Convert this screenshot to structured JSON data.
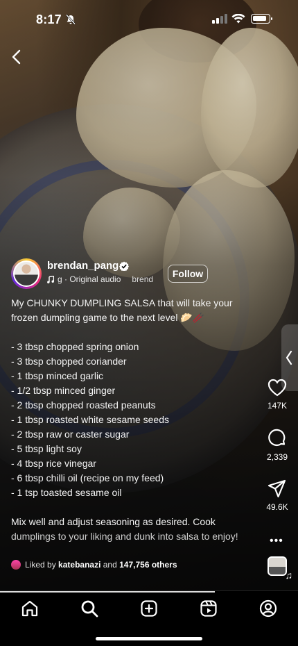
{
  "status_bar": {
    "time": "8:17"
  },
  "post": {
    "username": "brendan_pang",
    "audio_prefix": "g · Original audio",
    "audio_overflow": "brend",
    "follow_label": "Follow",
    "caption_intro": "My CHUNKY DUMPLING SALSA that will take your frozen dumpling game to the next level 🥟🥢",
    "ingredients": [
      "- 3 tbsp chopped spring onion",
      "- 3 tbsp chopped coriander",
      "- 1 tbsp minced garlic",
      "- 1/2 tbsp minced ginger",
      "- 2 tbsp chopped roasted peanuts",
      "- 1 tbsp roasted white sesame seeds",
      "- 2 tbsp raw or caster sugar",
      "- 5 tbsp light soy",
      "- 4 tbsp rice vinegar",
      "- 6 tbsp chilli oil (recipe on my feed)",
      "- 1 tsp toasted sesame oil"
    ],
    "caption_outro_1": "Mix well and adjust seasoning as desired. Cook",
    "caption_outro_2": "dumplings to your liking and dunk into salsa to enjoy!",
    "liked_prefix": "Liked by",
    "liked_user": "katebanazi",
    "liked_and": "and",
    "liked_others": "147,756 others"
  },
  "actions": {
    "likes": "147K",
    "comments": "2,339",
    "shares": "49.6K"
  },
  "video_progress": 0.72,
  "colors": {
    "accent_ring": [
      "#f9ce34",
      "#ee2a7b",
      "#6228d7"
    ],
    "verified": "#ffffff"
  },
  "icons": [
    "bell-slash-icon",
    "signal-icon",
    "wifi-icon",
    "battery-icon",
    "back-chevron-icon",
    "verified-icon",
    "music-note-icon",
    "heart-icon",
    "comment-icon",
    "send-icon",
    "more-icon",
    "home-icon",
    "search-icon",
    "create-icon",
    "reels-icon",
    "profile-icon"
  ]
}
